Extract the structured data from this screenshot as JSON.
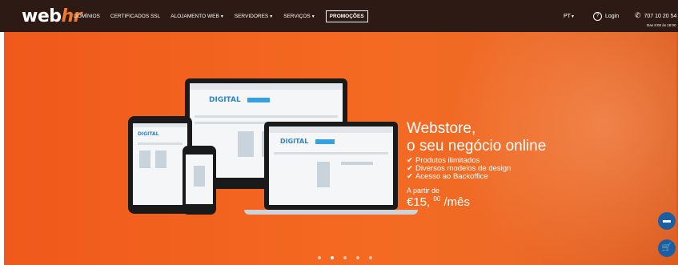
{
  "header": {
    "logo_main": "web",
    "logo_accent": "hr",
    "nav": [
      {
        "label": "DOMÍNIOS",
        "dropdown": false
      },
      {
        "label": "CERTIFICADOS SSL",
        "dropdown": false
      },
      {
        "label": "ALOJAMENTO WEB",
        "dropdown": true
      },
      {
        "label": "SERVIDORES",
        "dropdown": true
      },
      {
        "label": "SERVIÇOS",
        "dropdown": true
      },
      {
        "label": "PROMOÇÕES",
        "dropdown": false,
        "highlighted": true
      }
    ],
    "lang": "PT",
    "login": "Login",
    "phone": "707 10 20 54",
    "hours": "Das 9:00 às 18:00"
  },
  "hero": {
    "headline_line1": "Webstore,",
    "headline_line2": "o seu negócio online",
    "features": [
      "Produtos ilimitados",
      "Diversos modelos de design",
      "Acesso ao Backoffice"
    ],
    "from_label": "A partir de",
    "price_main": "€15,",
    "price_cents": "00",
    "price_period": "/mês",
    "screen_title": "DIGITAL"
  },
  "carousel": {
    "count": 5,
    "active_index": 1
  },
  "colors": {
    "topbar": "#2e1a14",
    "hero": "#f0591b",
    "accent": "#f07a2a",
    "fab": "#1a5fa3"
  },
  "icons": {
    "login": "user-circle-icon",
    "phone": "phone-icon",
    "check": "check-icon",
    "chat": "chat-icon",
    "cart": "cart-icon"
  }
}
